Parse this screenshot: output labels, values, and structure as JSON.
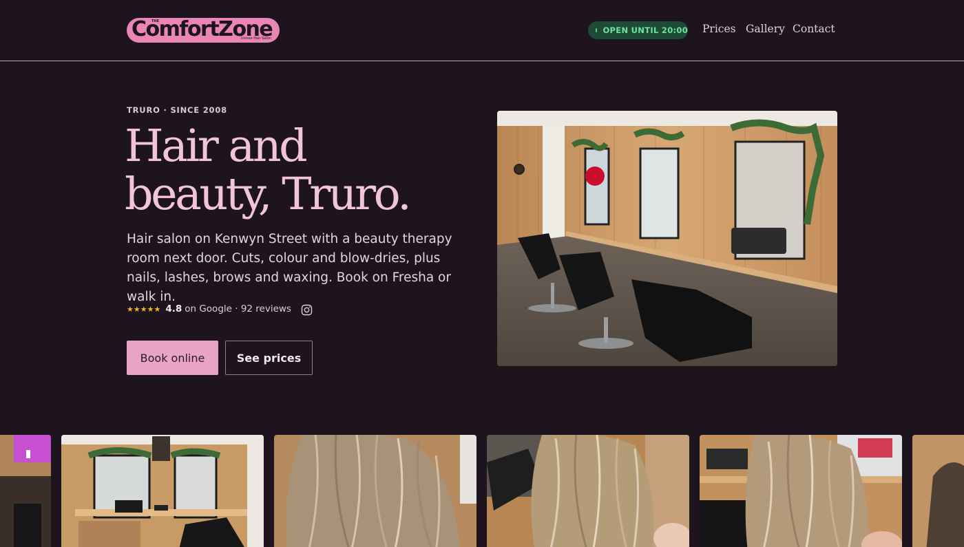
{
  "header": {
    "logo": {
      "small_text": "THE",
      "name": "ComfortZone",
      "tagline": "Unisex Hair Salon",
      "color": "#e986b6"
    },
    "status_badge": "OPEN UNTIL 20:00",
    "status_color": "#6fe3a0",
    "nav": [
      "Prices",
      "Gallery",
      "Contact"
    ]
  },
  "hero": {
    "eyebrow": "TRURO · SINCE 2008",
    "headline_line1": "Hair and",
    "headline_line2": "beauty, Truro.",
    "lede": "Hair salon on Kenwyn Street with a beauty therapy room next door. Cuts, colour and blow-dries, plus nails, lashes, brows and waxing. Book on Fresha or walk in.",
    "rating": {
      "stars": "★★★★★",
      "score": "4.8",
      "source": "on Google · 92 reviews"
    },
    "instagram_icon": "instagram-icon",
    "primary_button": "Book online",
    "secondary_button": "See prices"
  },
  "colors": {
    "background": "#1e141e",
    "accent_pink": "#e9a3c5",
    "headline_pink": "#f2c4da",
    "star_gold": "#f3b32a"
  }
}
